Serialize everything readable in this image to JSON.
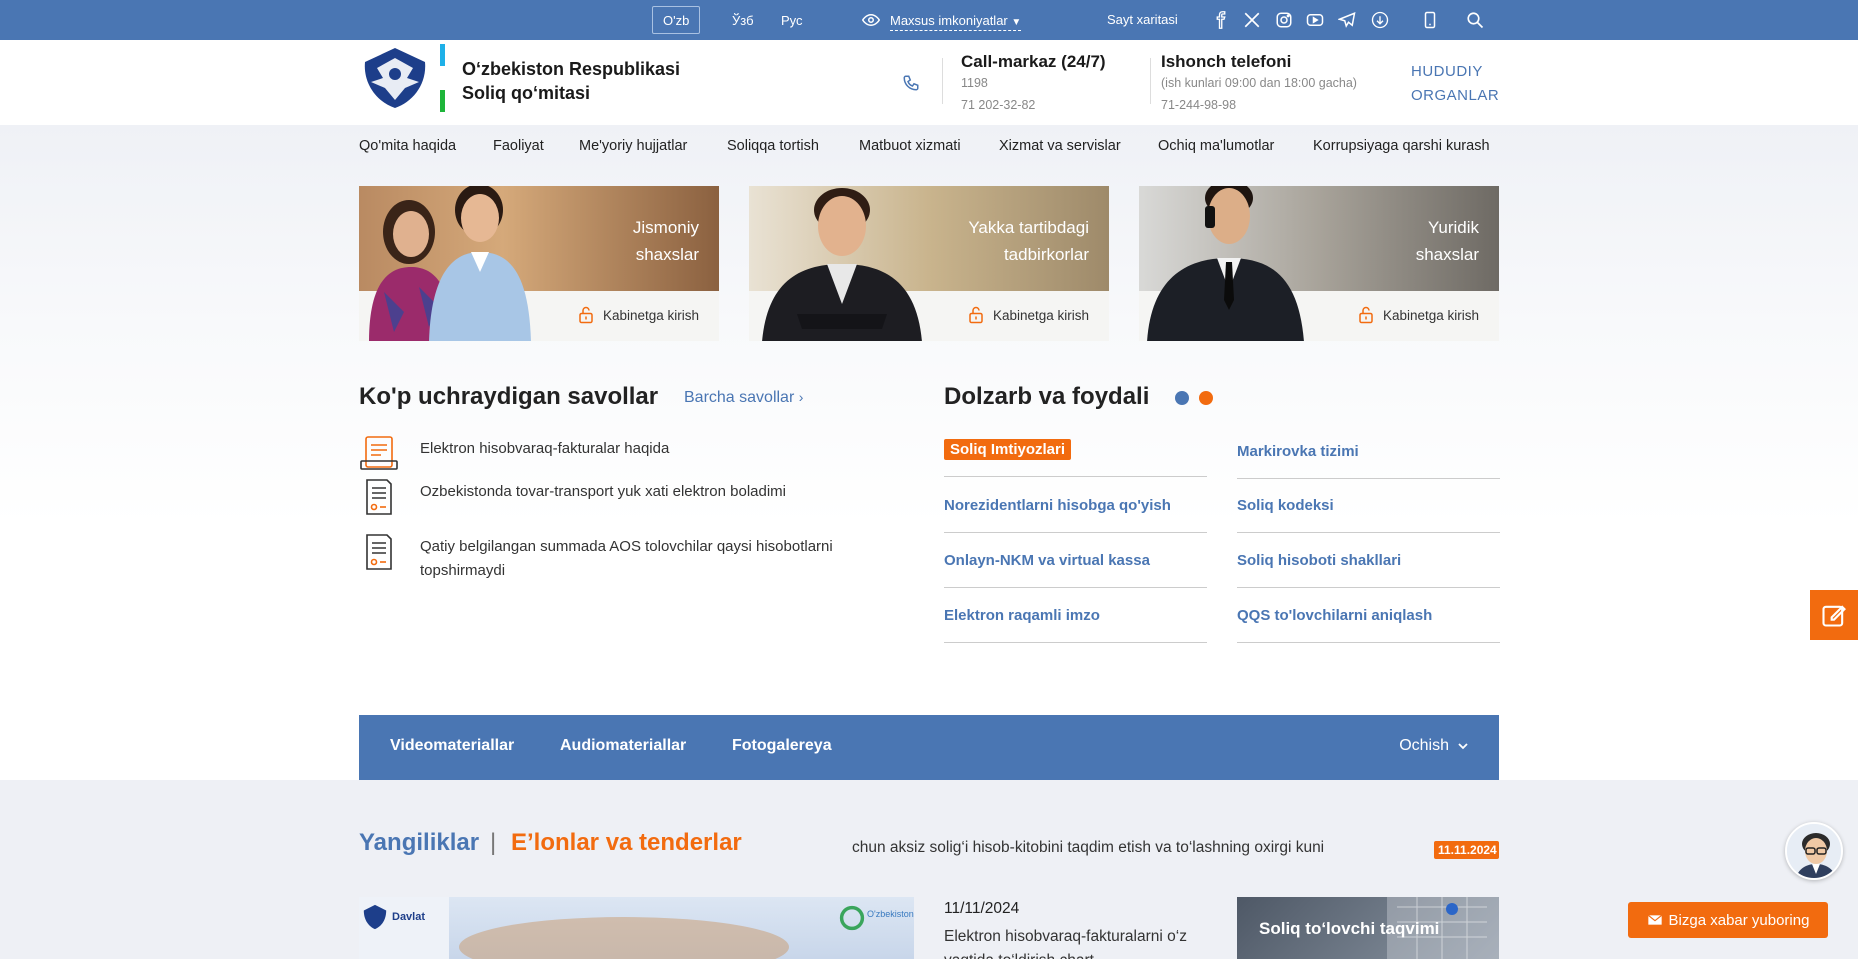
{
  "topbar": {
    "languages": [
      {
        "label": "O'zb",
        "active": true
      },
      {
        "label": "Ўзб",
        "active": false
      },
      {
        "label": "Рус",
        "active": false
      }
    ],
    "accessibility_label": "Maxsus imkoniyatlar",
    "sitemap_label": "Sayt xaritasi",
    "social_icons": [
      "facebook-icon",
      "x-icon",
      "instagram-icon",
      "youtube-icon",
      "telegram-icon",
      "ok-icon"
    ],
    "colors": {
      "bar": "#4a76b3"
    }
  },
  "header": {
    "org_line1": "O‘zbekiston Respublikasi",
    "org_line2": "Soliq qo‘mitasi",
    "call_center": {
      "title": "Call-markaz (24/7)",
      "short": "1198",
      "phone": "71 202-32-82"
    },
    "trust_phone": {
      "title": "Ishonch telefoni",
      "hours": "(ish kunlari 09:00 dan 18:00 gacha)",
      "phone": "71-244-98-98"
    },
    "regional_line1": "HUDUDIY",
    "regional_line2": "ORGANLAR"
  },
  "nav": {
    "items": [
      "Qo'mita haqida",
      "Faoliyat",
      "Me'yoriy hujjatlar",
      "Soliqqa tortish",
      "Matbuot xizmati",
      "Xizmat va servislar",
      "Ochiq ma'lumotlar",
      "Korrupsiyaga qarshi kurash"
    ]
  },
  "cards": [
    {
      "line1": "Jismoniy",
      "line2": "shaxslar",
      "cabinet": "Kabinetga kirish"
    },
    {
      "line1": "Yakka tartibdagi",
      "line2": "tadbirkorlar",
      "cabinet": "Kabinetga kirish"
    },
    {
      "line1": "Yuridik",
      "line2": "shaxslar",
      "cabinet": "Kabinetga kirish"
    }
  ],
  "faq": {
    "title": "Ko'p uchraydigan savollar",
    "see_all": "Barcha savollar",
    "items": [
      {
        "line1": "Elektron hisobvaraq-fakturalar haqida",
        "line2": ""
      },
      {
        "line1": "Ozbekistonda tovar-transport yuk xati elektron boladimi",
        "line2": ""
      },
      {
        "line1": "Qatiy belgilangan summada AOS tolovchilar qaysi hisobotlarni",
        "line2": "topshirmaydi"
      }
    ]
  },
  "useful": {
    "title": "Dolzarb va foydali",
    "dots": [
      {
        "color": "#4a76b3"
      },
      {
        "color": "#f26b0f"
      }
    ],
    "links_left": [
      "Soliq Imtiyozlari",
      "Norezidentlarni hisobga qo'yish",
      "Onlayn-NKM va virtual kassa",
      "Elektron raqamli imzo"
    ],
    "links_right": [
      "Markirovka tizimi",
      "Soliq kodeksi",
      "Soliq hisoboti shakllari",
      "QQS to'lovchilarni aniqlash"
    ]
  },
  "media": {
    "items": [
      "Videomateriallar",
      "Audiomateriallar",
      "Fotogalereya"
    ],
    "open_label": "Ochish"
  },
  "news": {
    "tab_news": "Yangiliklar",
    "separator": "|",
    "tab_tenders": "E’lonlar va tenderlar",
    "ticker_text": "chun aksiz solig‘i hisob-kitobini taqdim etish va to‘lashning oxirgi kuni",
    "ticker_date": "11.11.2024",
    "item_date": "11/11/2024",
    "item_line1": "Elektron hisobvaraq-fakturalarni o‘z",
    "item_line2": "vaqtida to‘ldirish chart",
    "calendar_title": "Soliq to‘lovchi taqvimi",
    "image_logo_left": "Davlat",
    "image_logo_right": "O'zbekiston"
  },
  "floating": {
    "send_label": "Bizga xabar yuboring"
  },
  "colors": {
    "accent": "#4a76b3",
    "orange": "#f26b0f"
  }
}
